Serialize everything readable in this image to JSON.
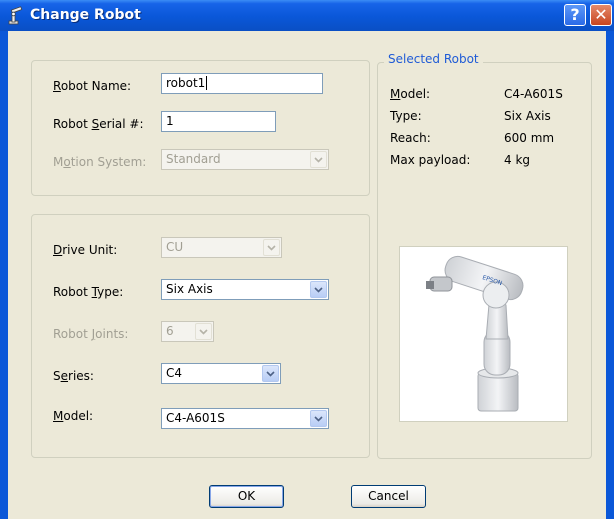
{
  "window": {
    "title": "Change Robot"
  },
  "general": {
    "robot_name_label_pre": "",
    "robot_name_label_u": "R",
    "robot_name_label_post": "obot Name:",
    "robot_name_value": "robot1",
    "serial_label_pre": "Robot ",
    "serial_label_u": "S",
    "serial_label_post": "erial #:",
    "serial_value": "1",
    "motion_label_pre": "M",
    "motion_label_u": "o",
    "motion_label_post": "tion System:",
    "motion_value": "Standard"
  },
  "config": {
    "drive_label_pre": "",
    "drive_label_u": "D",
    "drive_label_post": "rive Unit:",
    "drive_value": "CU",
    "type_label_pre": "Robot ",
    "type_label_u": "T",
    "type_label_post": "ype:",
    "type_value": "Six Axis",
    "joints_label_pre": "Robot ",
    "joints_label_u": "J",
    "joints_label_post": "oints:",
    "joints_value": "6",
    "series_label_pre": "S",
    "series_label_u": "e",
    "series_label_post": "ries:",
    "series_value": "C4",
    "model_label_pre": "",
    "model_label_u": "M",
    "model_label_post": "odel:",
    "model_value": "C4-A601S"
  },
  "selected": {
    "legend": "Selected Robot",
    "model_label_u": "M",
    "model_label_post": "odel:",
    "model_value": "C4-A601S",
    "type_label": "Type:",
    "type_value": "Six Axis",
    "reach_label": "Reach:",
    "reach_value": "600 mm",
    "payload_label": "Max payload:",
    "payload_value": "4 kg",
    "photo_brand": "EPSON"
  },
  "buttons": {
    "ok": "OK",
    "cancel": "Cancel"
  },
  "icons": {
    "title": "robot-arm-icon",
    "help": "help-icon",
    "close": "close-icon",
    "dropdown": "chevron-down-icon"
  },
  "colors": {
    "titlebar": "#0a57d8",
    "dialog_bg": "#ece9d8",
    "legend": "#1f5bd6",
    "close": "#c8451f"
  }
}
